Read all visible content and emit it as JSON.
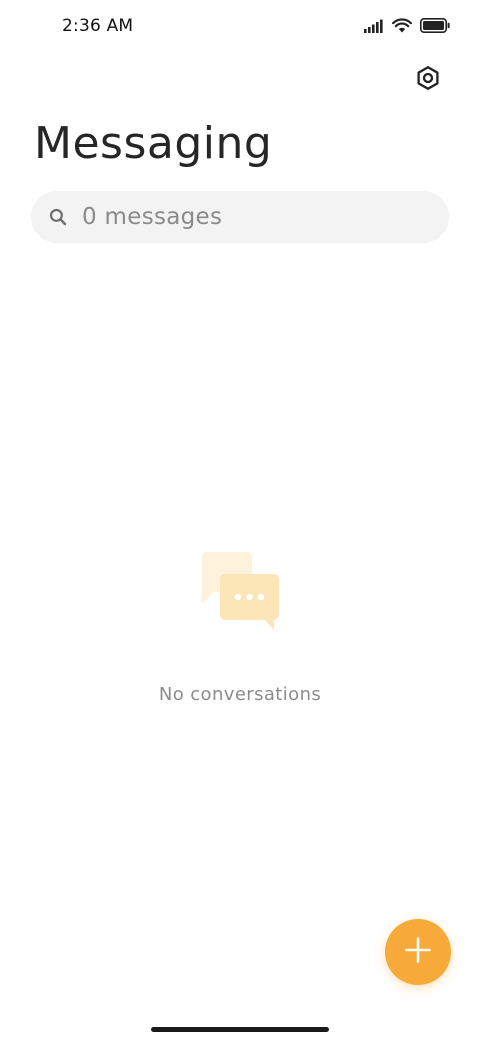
{
  "status_bar": {
    "time": "2:36 AM",
    "icons": [
      "signal-icon",
      "wifi-icon",
      "battery-icon"
    ]
  },
  "header": {
    "title": "Messaging",
    "settings_icon": "settings-icon"
  },
  "search": {
    "placeholder": "0 messages",
    "icon": "search-icon"
  },
  "empty_state": {
    "icon": "conversation-bubbles-icon",
    "text": "No conversations"
  },
  "fab": {
    "icon": "plus-icon",
    "color": "#f7a93a"
  },
  "colors": {
    "accent": "#f7a93a",
    "empty_icon_light": "#fdf3dd",
    "empty_icon_dark": "#fce6b8"
  }
}
